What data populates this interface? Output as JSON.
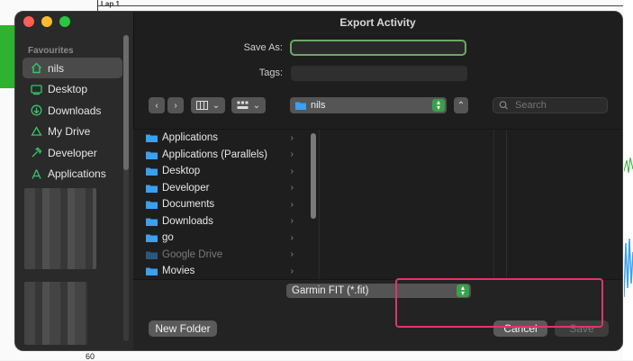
{
  "background": {
    "lap_label": "Lap 1",
    "axis_tick": "60"
  },
  "window": {
    "title": "Export Activity"
  },
  "sidebar": {
    "section_title": "Favourites",
    "items": [
      {
        "label": "nils",
        "icon": "home-icon",
        "selected": true
      },
      {
        "label": "Desktop",
        "icon": "desktop-icon"
      },
      {
        "label": "Downloads",
        "icon": "downloads-icon"
      },
      {
        "label": "My Drive",
        "icon": "drive-icon"
      },
      {
        "label": "Developer",
        "icon": "hammer-icon"
      },
      {
        "label": "Applications",
        "icon": "applications-icon"
      }
    ]
  },
  "form": {
    "save_as_label": "Save As:",
    "save_as_value": "",
    "tags_label": "Tags:",
    "tags_value": ""
  },
  "toolbar": {
    "location": "nils",
    "search_placeholder": "Search"
  },
  "browser": {
    "items": [
      {
        "name": "Applications",
        "dim": false
      },
      {
        "name": "Applications (Parallels)",
        "dim": false
      },
      {
        "name": "Desktop",
        "dim": false
      },
      {
        "name": "Developer",
        "dim": false
      },
      {
        "name": "Documents",
        "dim": false
      },
      {
        "name": "Downloads",
        "dim": false
      },
      {
        "name": "go",
        "dim": false
      },
      {
        "name": "Google Drive",
        "dim": true
      },
      {
        "name": "Movies",
        "dim": false
      }
    ]
  },
  "format": {
    "selected": "Garmin FIT (*.fit)"
  },
  "buttons": {
    "new_folder": "New Folder",
    "cancel": "Cancel",
    "save": "Save"
  },
  "colors": {
    "accent_green": "#37a14b",
    "highlight": "#e0356b",
    "folder_blue": "#3aa0f0"
  }
}
